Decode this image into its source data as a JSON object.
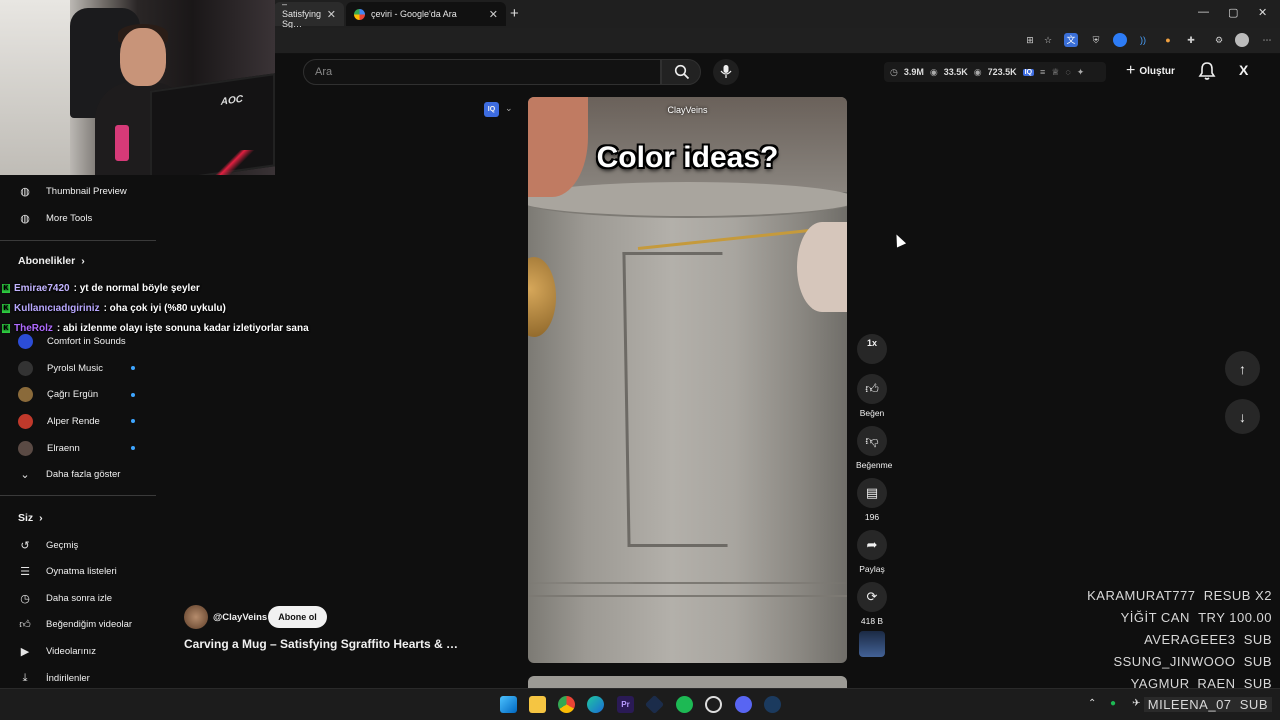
{
  "browser": {
    "tabs": [
      {
        "label": "– Satisfying Sg…"
      },
      {
        "label": "çeviri - Google'da Ara"
      }
    ],
    "new_tab": "+",
    "window_controls": [
      "—",
      "▢",
      "✕"
    ]
  },
  "header": {
    "search_placeholder": "Ara",
    "stats": {
      "watch_time": "3.9M",
      "views": "33.5K",
      "subs": "723.5K"
    },
    "create_label": "Oluştur",
    "x_label": "X"
  },
  "sidebar": {
    "tools": [
      {
        "label": "Thumbnail Preview",
        "icon": "tool-icon"
      },
      {
        "label": "More Tools",
        "icon": "tool-icon"
      }
    ],
    "subscriptions_heading": "Abonelikler",
    "subscriptions": [
      {
        "label": "Comfort in Sounds",
        "color": "#2c4dd6",
        "new": false
      },
      {
        "label": "Pyrolsl Music",
        "color": "#333333",
        "new": true
      },
      {
        "label": "Çağrı Ergün",
        "color": "#8a6a3a",
        "new": true
      },
      {
        "label": "Alper Rende",
        "color": "#c0392b",
        "new": true
      },
      {
        "label": "Elraenn",
        "color": "#5a4a44",
        "new": true
      }
    ],
    "show_more": "Daha fazla göster",
    "you_heading": "Siz",
    "you_items": [
      {
        "label": "Geçmiş",
        "icon": "history-icon"
      },
      {
        "label": "Oynatma listeleri",
        "icon": "playlist-icon"
      },
      {
        "label": "Daha sonra izle",
        "icon": "clock-icon"
      },
      {
        "label": "Beğendiğim videolar",
        "icon": "like-icon"
      },
      {
        "label": "Videolarınız",
        "icon": "video-icon"
      },
      {
        "label": "İndirilenler",
        "icon": "download-icon"
      }
    ]
  },
  "chat": [
    {
      "user": "Emirae7420",
      "message": ": yt de normal böyle şeyler"
    },
    {
      "user": "Kullanıcıadıgiriniz",
      "message": ": oha çok iyi (%80 uykulu)"
    },
    {
      "user": "TheRolz",
      "message": ": abi izlenme olayı işte sonuna kadar izletiyorlar sana"
    }
  ],
  "video": {
    "channel_overlay": "ClayVeins",
    "caption": "Color ideas?",
    "handle": "@ClayVeins",
    "subscribe_label": "Abone ol",
    "title": "Carving a Mug – Satisfying Sgraffito Hearts & …",
    "speed": "1x"
  },
  "actions": {
    "like": "Beğen",
    "dislike": "Beğenme",
    "comments": "196",
    "share": "Paylaş",
    "remix": "418 B"
  },
  "alerts": [
    {
      "name": "KARAMURAT777",
      "event": "RESUB X2",
      "color": "#9a9a9a"
    },
    {
      "name": "YİĞİT CAN",
      "event": "TRY 100.00",
      "color": "#a8a8a8"
    },
    {
      "name": "AVERAGEEE3",
      "event": "SUB",
      "color": "#b5b5b5"
    },
    {
      "name": "SSUNG_JINWOOO",
      "event": "SUB",
      "color": "#dcdcdc"
    },
    {
      "name": "YAGMUR_RAEN",
      "event": "SUB",
      "color": "#f2f2f2"
    },
    {
      "name": "MILEENA_07",
      "event": "SUB",
      "color": "#ffffff"
    }
  ],
  "taskbar": {
    "apps": [
      "windows-icon",
      "file-explorer-icon",
      "chrome-icon",
      "edge-icon",
      "premiere-icon",
      "app-icon",
      "spotify-icon",
      "app-icon",
      "discord-icon",
      "steam-icon"
    ]
  }
}
